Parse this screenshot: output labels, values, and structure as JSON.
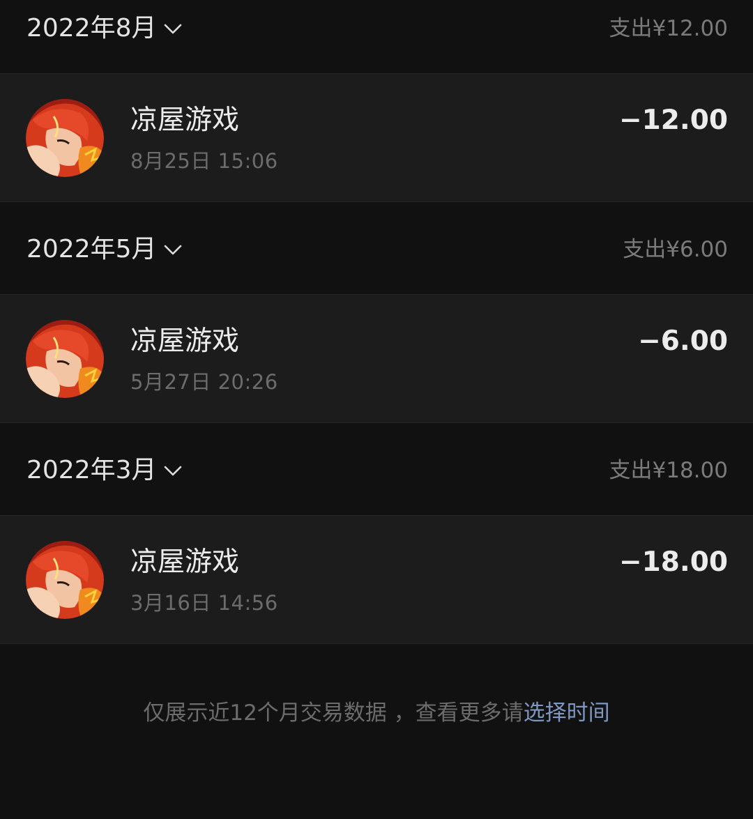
{
  "groups": [
    {
      "month": "2022年8月",
      "total": "支出¥12.00",
      "transactions": [
        {
          "name": "凉屋游戏",
          "time": "8月25日  15:06",
          "amount": "−12.00"
        }
      ]
    },
    {
      "month": "2022年5月",
      "total": "支出¥6.00",
      "transactions": [
        {
          "name": "凉屋游戏",
          "time": "5月27日  20:26",
          "amount": "−6.00"
        }
      ]
    },
    {
      "month": "2022年3月",
      "total": "支出¥18.00",
      "transactions": [
        {
          "name": "凉屋游戏",
          "time": "3月16日  14:56",
          "amount": "−18.00"
        }
      ]
    }
  ],
  "footer": {
    "note": "仅展示近12个月交易数据 ，查看更多请",
    "link": "选择时间"
  },
  "icons": {
    "chevron": "chevron-down-icon",
    "avatar": "merchant-avatar-icon"
  },
  "colors": {
    "background": "#111111",
    "row_background": "#1c1c1c",
    "link": "#7e98c2"
  }
}
